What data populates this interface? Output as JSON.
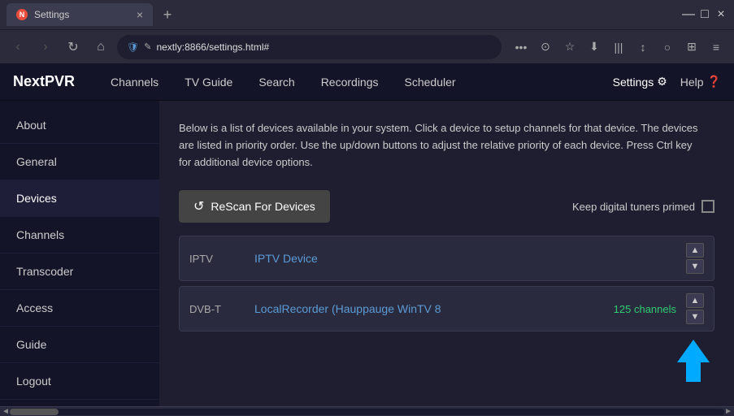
{
  "browser": {
    "tab": {
      "icon": "N",
      "title": "Settings",
      "close": "×"
    },
    "new_tab": "+",
    "window_controls": {
      "minimize": "—",
      "maximize": "□",
      "close": "×"
    },
    "nav": {
      "back": "‹",
      "forward": "›",
      "refresh": "↻",
      "home": "⌂"
    },
    "address": {
      "url": "nextly:8866/settings.html#",
      "shield": "🛡",
      "lock": "✎"
    },
    "toolbar_dots": "•••"
  },
  "app": {
    "logo": "NextPVR",
    "nav_items": [
      "Channels",
      "TV Guide",
      "Search",
      "Recordings",
      "Scheduler"
    ],
    "settings_label": "Settings",
    "settings_icon": "⚙",
    "help_label": "Help",
    "help_icon": "❓"
  },
  "sidebar": {
    "items": [
      {
        "label": "About",
        "active": false
      },
      {
        "label": "General",
        "active": false
      },
      {
        "label": "Devices",
        "active": true
      },
      {
        "label": "Channels",
        "active": false
      },
      {
        "label": "Transcoder",
        "active": false
      },
      {
        "label": "Access",
        "active": false
      },
      {
        "label": "Guide",
        "active": false
      },
      {
        "label": "Logout",
        "active": false
      }
    ]
  },
  "content": {
    "description": "Below is a list of devices available in your system. Click a device to setup channels for that device. The devices are listed in priority order. Use the up/down buttons to adjust the relative priority of each device. Press Ctrl key for additional device options.",
    "rescan_btn": "ReScan For Devices",
    "rescan_icon": "↺",
    "keep_tuners_label": "Keep digital tuners primed",
    "devices": [
      {
        "type": "IPTV",
        "name": "IPTV Device",
        "channels": ""
      },
      {
        "type": "DVB-T",
        "name": "LocalRecorder (Hauppauge WinTV 8",
        "channels": "125 channels"
      }
    ]
  }
}
